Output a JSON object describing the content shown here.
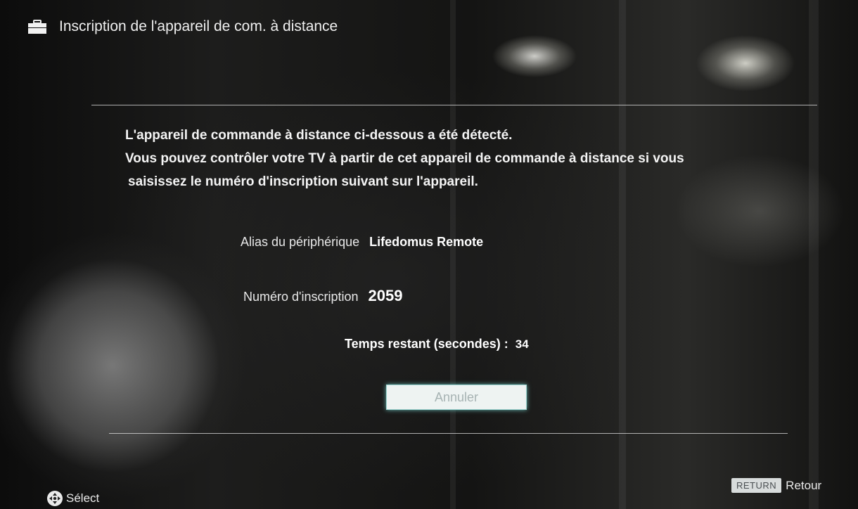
{
  "header": {
    "icon": "toolbox-icon",
    "title": "Inscription de l'appareil de com. à distance"
  },
  "message": {
    "line1": "L'appareil de commande à distance ci-dessous a été détecté.",
    "line2": "Vous pouvez contrôler votre TV à partir de cet appareil de commande à distance si vous",
    "line3": "saisissez le numéro d'inscription suivant sur l'appareil."
  },
  "device": {
    "alias_label": "Alias du périphérique",
    "alias_value": "Lifedomus Remote",
    "number_label": "Numéro d'inscription",
    "number_value": "2059",
    "time_label": "Temps restant (secondes) :",
    "time_value": "34"
  },
  "cancel_button": {
    "label": "Annuler"
  },
  "footer": {
    "select_icon": "dpad-icon",
    "select_label": "Sélect",
    "return_key": "RETURN",
    "return_label": "Retour"
  },
  "colors": {
    "focus_glow": "#9ed8d4",
    "button_bg": "#eef3f2",
    "text": "#f4f4f4"
  }
}
